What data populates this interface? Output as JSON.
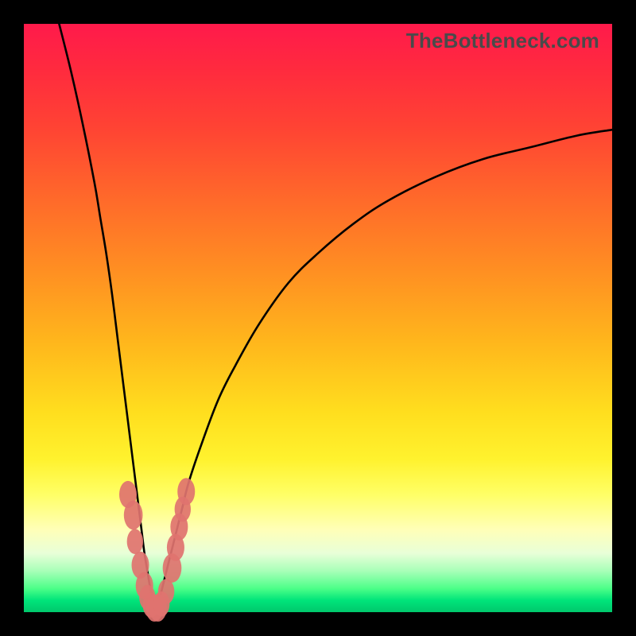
{
  "watermark": "TheBottleneck.com",
  "chart_data": {
    "type": "line",
    "title": "",
    "xlabel": "",
    "ylabel": "",
    "xlim": [
      0,
      100
    ],
    "ylim": [
      0,
      100
    ],
    "grid": false,
    "legend": false,
    "series": [
      {
        "name": "left-curve",
        "x": [
          6,
          8,
          10,
          12,
          13,
          14,
          15,
          16,
          17,
          18,
          19,
          20,
          20.5,
          21,
          21.5,
          22,
          22.5
        ],
        "values": [
          100,
          92,
          83,
          73,
          67,
          61,
          54,
          46,
          38,
          30,
          22,
          14,
          10,
          7,
          4,
          2,
          0
        ]
      },
      {
        "name": "right-curve",
        "x": [
          22.5,
          23,
          23.5,
          24,
          25,
          26,
          27,
          28,
          30,
          33,
          36,
          40,
          45,
          50,
          56,
          62,
          70,
          78,
          86,
          94,
          100
        ],
        "values": [
          0,
          2,
          4,
          6,
          10,
          14,
          18,
          22,
          28,
          36,
          42,
          49,
          56,
          61,
          66,
          70,
          74,
          77,
          79,
          81,
          82
        ]
      }
    ],
    "markers": {
      "name": "cluster-dots",
      "color": "#e0736f",
      "points": [
        {
          "x": 17.7,
          "y": 20.0,
          "r": 1.6
        },
        {
          "x": 18.6,
          "y": 16.5,
          "r": 1.8
        },
        {
          "x": 18.9,
          "y": 12.0,
          "r": 1.4
        },
        {
          "x": 19.8,
          "y": 8.0,
          "r": 1.6
        },
        {
          "x": 20.5,
          "y": 4.5,
          "r": 1.6
        },
        {
          "x": 21.0,
          "y": 2.5,
          "r": 1.4
        },
        {
          "x": 21.6,
          "y": 1.2,
          "r": 1.4
        },
        {
          "x": 22.2,
          "y": 0.7,
          "r": 1.6
        },
        {
          "x": 22.8,
          "y": 0.7,
          "r": 1.6
        },
        {
          "x": 23.4,
          "y": 1.4,
          "r": 1.4
        },
        {
          "x": 24.2,
          "y": 3.5,
          "r": 1.4
        },
        {
          "x": 25.2,
          "y": 7.5,
          "r": 1.8
        },
        {
          "x": 25.8,
          "y": 11.0,
          "r": 1.6
        },
        {
          "x": 26.4,
          "y": 14.5,
          "r": 1.6
        },
        {
          "x": 27.0,
          "y": 17.5,
          "r": 1.4
        },
        {
          "x": 27.6,
          "y": 20.5,
          "r": 1.6
        }
      ]
    }
  }
}
